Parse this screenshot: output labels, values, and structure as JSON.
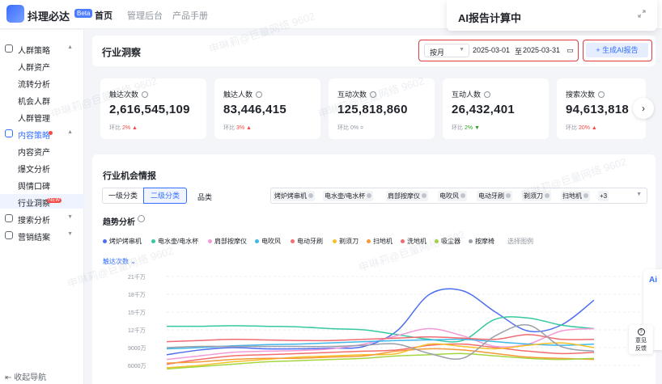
{
  "app": {
    "name": "抖理必达",
    "badge": "Beta"
  },
  "nav": [
    {
      "label": "首页",
      "active": true
    },
    {
      "label": "管理后台",
      "active": false
    },
    {
      "label": "产品手册",
      "active": false
    }
  ],
  "ai_popup": {
    "title": "AI报告计算中"
  },
  "sidebar": {
    "items": [
      {
        "label": "人群策略",
        "type": "group"
      },
      {
        "label": "人群资产",
        "type": "sub"
      },
      {
        "label": "流转分析",
        "type": "sub"
      },
      {
        "label": "机会人群",
        "type": "sub"
      },
      {
        "label": "人群管理",
        "type": "sub"
      },
      {
        "label": "内容策略",
        "type": "group"
      },
      {
        "label": "内容资产",
        "type": "sub"
      },
      {
        "label": "爆文分析",
        "type": "sub"
      },
      {
        "label": "舆情口碑",
        "type": "sub"
      },
      {
        "label": "行业洞察",
        "type": "sub",
        "badge": "NEW"
      },
      {
        "label": "搜索分析",
        "type": "group"
      },
      {
        "label": "营销结案",
        "type": "group"
      }
    ],
    "collapse_label": "收起导航"
  },
  "header": {
    "title": "行业洞察",
    "period": "按月",
    "date_start": "2025-03-01",
    "date_sep": "至",
    "date_end": "2025-03-31",
    "generate_label": "+ 生成AI报告"
  },
  "metrics": [
    {
      "title": "触达次数",
      "value": "2,616,545,109",
      "ratio_label": "环比",
      "ratio": "2%",
      "trend": "up"
    },
    {
      "title": "触达人数",
      "value": "83,446,415",
      "ratio_label": "环比",
      "ratio": "3%",
      "trend": "up"
    },
    {
      "title": "互动次数",
      "value": "125,818,860",
      "ratio_label": "环比",
      "ratio": "0%",
      "trend": "flat"
    },
    {
      "title": "互动人数",
      "value": "26,432,401",
      "ratio_label": "环比",
      "ratio": "2%",
      "trend": "down"
    },
    {
      "title": "搜索次数",
      "value": "94,613,818",
      "ratio_label": "环比",
      "ratio": "20%",
      "trend": "up"
    }
  ],
  "opportunity": {
    "title": "行业机会情报",
    "level_tabs": [
      "一级分类",
      "二级分类"
    ],
    "category_label": "品类",
    "tags": [
      "烤炉烤串机",
      "电水壶/电水杯",
      "肩部按摩仪",
      "电吹风",
      "电动牙刷",
      "剃须刀",
      "扫地机"
    ],
    "more_tags": "+3",
    "trend_title": "趋势分析",
    "legend": [
      {
        "name": "烤炉烤串机",
        "color": "#4e6ef2"
      },
      {
        "name": "电水壶/电水杯",
        "color": "#36c9a0"
      },
      {
        "name": "肩部按摩仪",
        "color": "#f29ad8"
      },
      {
        "name": "电吹风",
        "color": "#3fb8e8"
      },
      {
        "name": "电动牙刷",
        "color": "#f46d6d"
      },
      {
        "name": "剃须刀",
        "color": "#f5c02a"
      },
      {
        "name": "扫地机",
        "color": "#f59a3a"
      },
      {
        "name": "洗地机",
        "color": "#ef6b73"
      },
      {
        "name": "吸尘器",
        "color": "#a5d63f"
      },
      {
        "name": "按摩椅",
        "color": "#9aa0aa"
      }
    ],
    "legend_more": "选择图例",
    "metric_select": "触达次数"
  },
  "chart_data": {
    "type": "line",
    "yticks": [
      "21千万",
      "18千万",
      "15千万",
      "12千万",
      "9000万",
      "6000万"
    ],
    "ylim": [
      45000000,
      210000000
    ],
    "x": [
      0,
      1,
      2,
      3,
      4,
      5,
      6,
      7,
      8,
      9,
      10,
      11,
      12,
      13
    ],
    "series": [
      {
        "name": "烤炉烤串机",
        "values": [
          78000000,
          86000000,
          90000000,
          88000000,
          88000000,
          89000000,
          92000000,
          118000000,
          180000000,
          186000000,
          150000000,
          118000000,
          128000000,
          170000000
        ]
      },
      {
        "name": "电水壶/电水杯",
        "values": [
          126000000,
          126000000,
          127000000,
          126000000,
          125000000,
          122000000,
          120000000,
          112000000,
          104000000,
          102000000,
          138000000,
          140000000,
          128000000,
          122000000
        ]
      },
      {
        "name": "肩部按摩仪",
        "values": [
          70000000,
          76000000,
          82000000,
          84000000,
          85000000,
          88000000,
          96000000,
          110000000,
          122000000,
          110000000,
          92000000,
          96000000,
          118000000,
          122000000
        ]
      },
      {
        "name": "电吹风",
        "values": [
          88000000,
          90000000,
          93000000,
          95000000,
          96000000,
          98000000,
          100000000,
          102000000,
          103000000,
          104000000,
          100000000,
          96000000,
          94000000,
          96000000
        ]
      },
      {
        "name": "电动牙刷",
        "values": [
          62000000,
          70000000,
          76000000,
          78000000,
          80000000,
          82000000,
          84000000,
          86000000,
          94000000,
          96000000,
          90000000,
          84000000,
          80000000,
          82000000
        ]
      },
      {
        "name": "剃须刀",
        "values": [
          56000000,
          60000000,
          66000000,
          70000000,
          74000000,
          76000000,
          78000000,
          80000000,
          96000000,
          92000000,
          88000000,
          94000000,
          98000000,
          90000000
        ]
      },
      {
        "name": "扫地机",
        "values": [
          64000000,
          66000000,
          70000000,
          72000000,
          72000000,
          74000000,
          76000000,
          84000000,
          88000000,
          86000000,
          80000000,
          74000000,
          72000000,
          70000000
        ]
      },
      {
        "name": "洗地机",
        "values": [
          100000000,
          102000000,
          104000000,
          103000000,
          102000000,
          102000000,
          104000000,
          106000000,
          108000000,
          106000000,
          104000000,
          112000000,
          104000000,
          104000000
        ]
      },
      {
        "name": "吸尘器",
        "values": [
          54000000,
          58000000,
          62000000,
          66000000,
          68000000,
          70000000,
          72000000,
          76000000,
          78000000,
          80000000,
          76000000,
          72000000,
          70000000,
          72000000
        ]
      },
      {
        "name": "按摩椅",
        "values": [
          90000000,
          92000000,
          92000000,
          92000000,
          92000000,
          92000000,
          94000000,
          96000000,
          80000000,
          72000000,
          110000000,
          128000000,
          92000000,
          84000000
        ]
      }
    ]
  }
}
